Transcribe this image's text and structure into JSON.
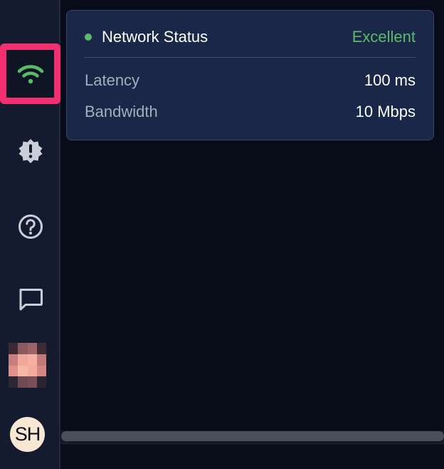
{
  "sidebar": {
    "network_icon": "wifi-icon",
    "bug_icon": "alert-badge-icon",
    "help_icon": "question-circle-icon",
    "chat_icon": "chat-bubble-icon",
    "avatar_initials": "SH"
  },
  "popover": {
    "title": "Network Status",
    "status": "Excellent",
    "rows": [
      {
        "label": "Latency",
        "value": "100 ms"
      },
      {
        "label": "Bandwidth",
        "value": "10 Mbps"
      }
    ]
  },
  "colors": {
    "accent_green": "#5cba6a",
    "highlight_pink": "#f2306f",
    "popover_bg": "#1a2748",
    "sidebar_bg": "#141b2e",
    "main_bg": "#080b18"
  }
}
